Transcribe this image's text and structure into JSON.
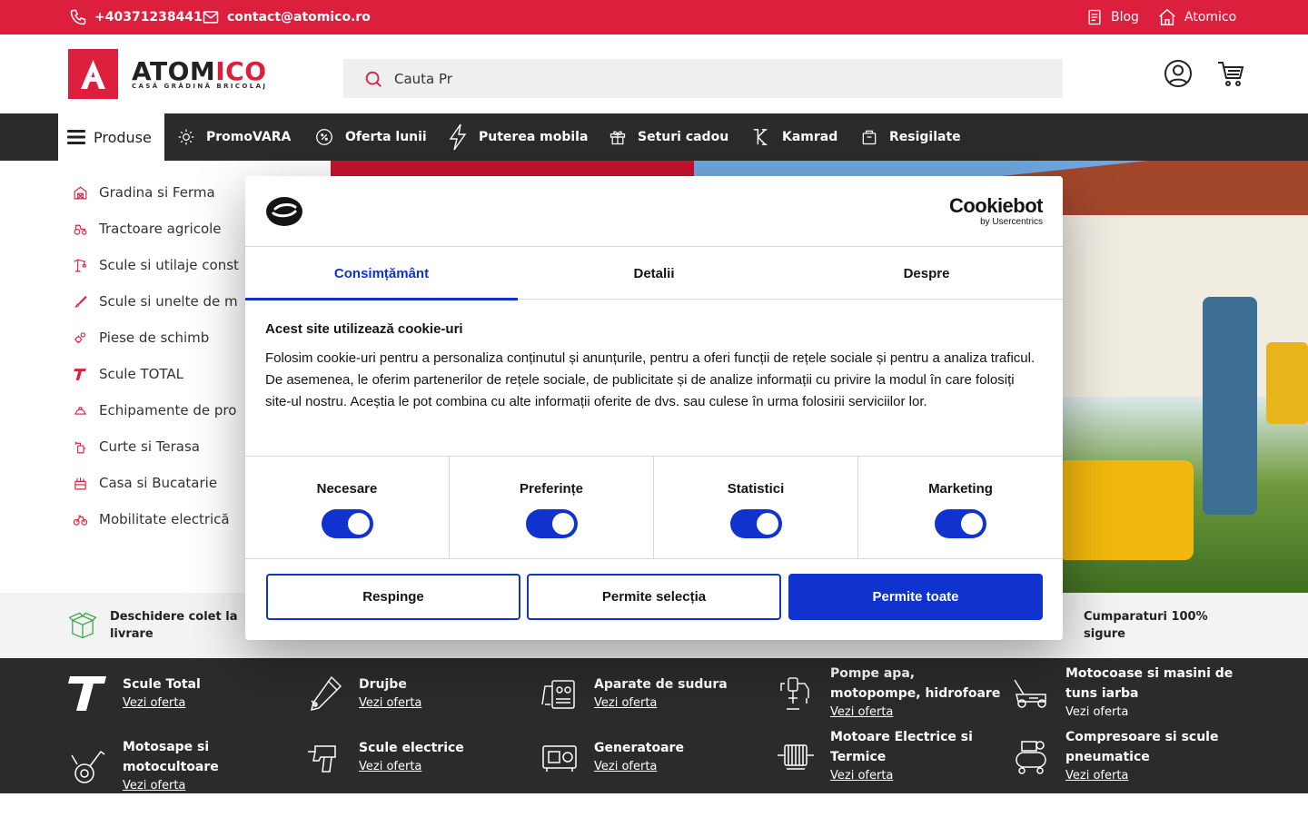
{
  "topbar": {
    "phone": "+40371238441",
    "email": "contact@atomico.ro",
    "blog": "Blog",
    "home": "Atomico"
  },
  "header": {
    "logo_text_black": "ATOM",
    "logo_text_red": "ICO",
    "logo_tagline": "CASĂ GRĂDINĂ BRICOLAJ",
    "search_value": "Cauta Pr",
    "search_placeholder": "Cauta Pr"
  },
  "nav": {
    "products": "Produse",
    "items": [
      "PromoVARA",
      "Oferta lunii",
      "Puterea mobila",
      "Seturi cadou",
      "Kamrad",
      "Resigilate"
    ]
  },
  "sidebar": {
    "items": [
      "Gradina si Ferma",
      "Tractoare agricole",
      "Scule si utilaje const",
      "Scule si unelte de m",
      "Piese de schimb",
      "Scule TOTAL",
      "Echipamente de pro",
      "Curte si Terasa",
      "Casa si Bucatarie",
      "Mobilitate electrică"
    ]
  },
  "benefits": {
    "left": "Deschidere colet la livrare",
    "right": "Cumparaturi 100% sigure"
  },
  "categories": {
    "link_label": "Vezi oferta",
    "items": [
      "Scule Total",
      "Drujbe",
      "Aparate de sudura",
      "Pompe apa, motopompe, hidrofoare",
      "Motocoase si masini de tuns iarba",
      "Motosape si motocultoare",
      "Scule electrice",
      "Generatoare",
      "Motoare Electrice si Termice",
      "Compresoare si scule pneumatice"
    ]
  },
  "cookie": {
    "brand": "Cookiebot",
    "brand_sub": "by Usercentrics",
    "tabs": [
      "Consimțământ",
      "Detalii",
      "Despre"
    ],
    "title": "Acest site utilizează cookie-uri",
    "text": "Folosim cookie-uri pentru a personaliza conținutul și anunțurile, pentru a oferi funcții de rețele sociale și pentru a analiza traficul. De asemenea, le oferim partenerilor de rețele sociale, de publicitate și de analize informații cu privire la modul în care folosiți site-ul nostru. Aceștia le pot combina cu alte informații oferite de dvs. sau culese în urma folosirii serviciilor lor.",
    "toggles": [
      "Necesare",
      "Preferințe",
      "Statistici",
      "Marketing"
    ],
    "buttons": {
      "reject": "Respinge",
      "selection": "Permite selecția",
      "all": "Permite toate"
    }
  },
  "colors": {
    "brand_red": "#dc1f3c",
    "dark": "#2b2b2b",
    "cookie_blue": "#1032cf"
  }
}
